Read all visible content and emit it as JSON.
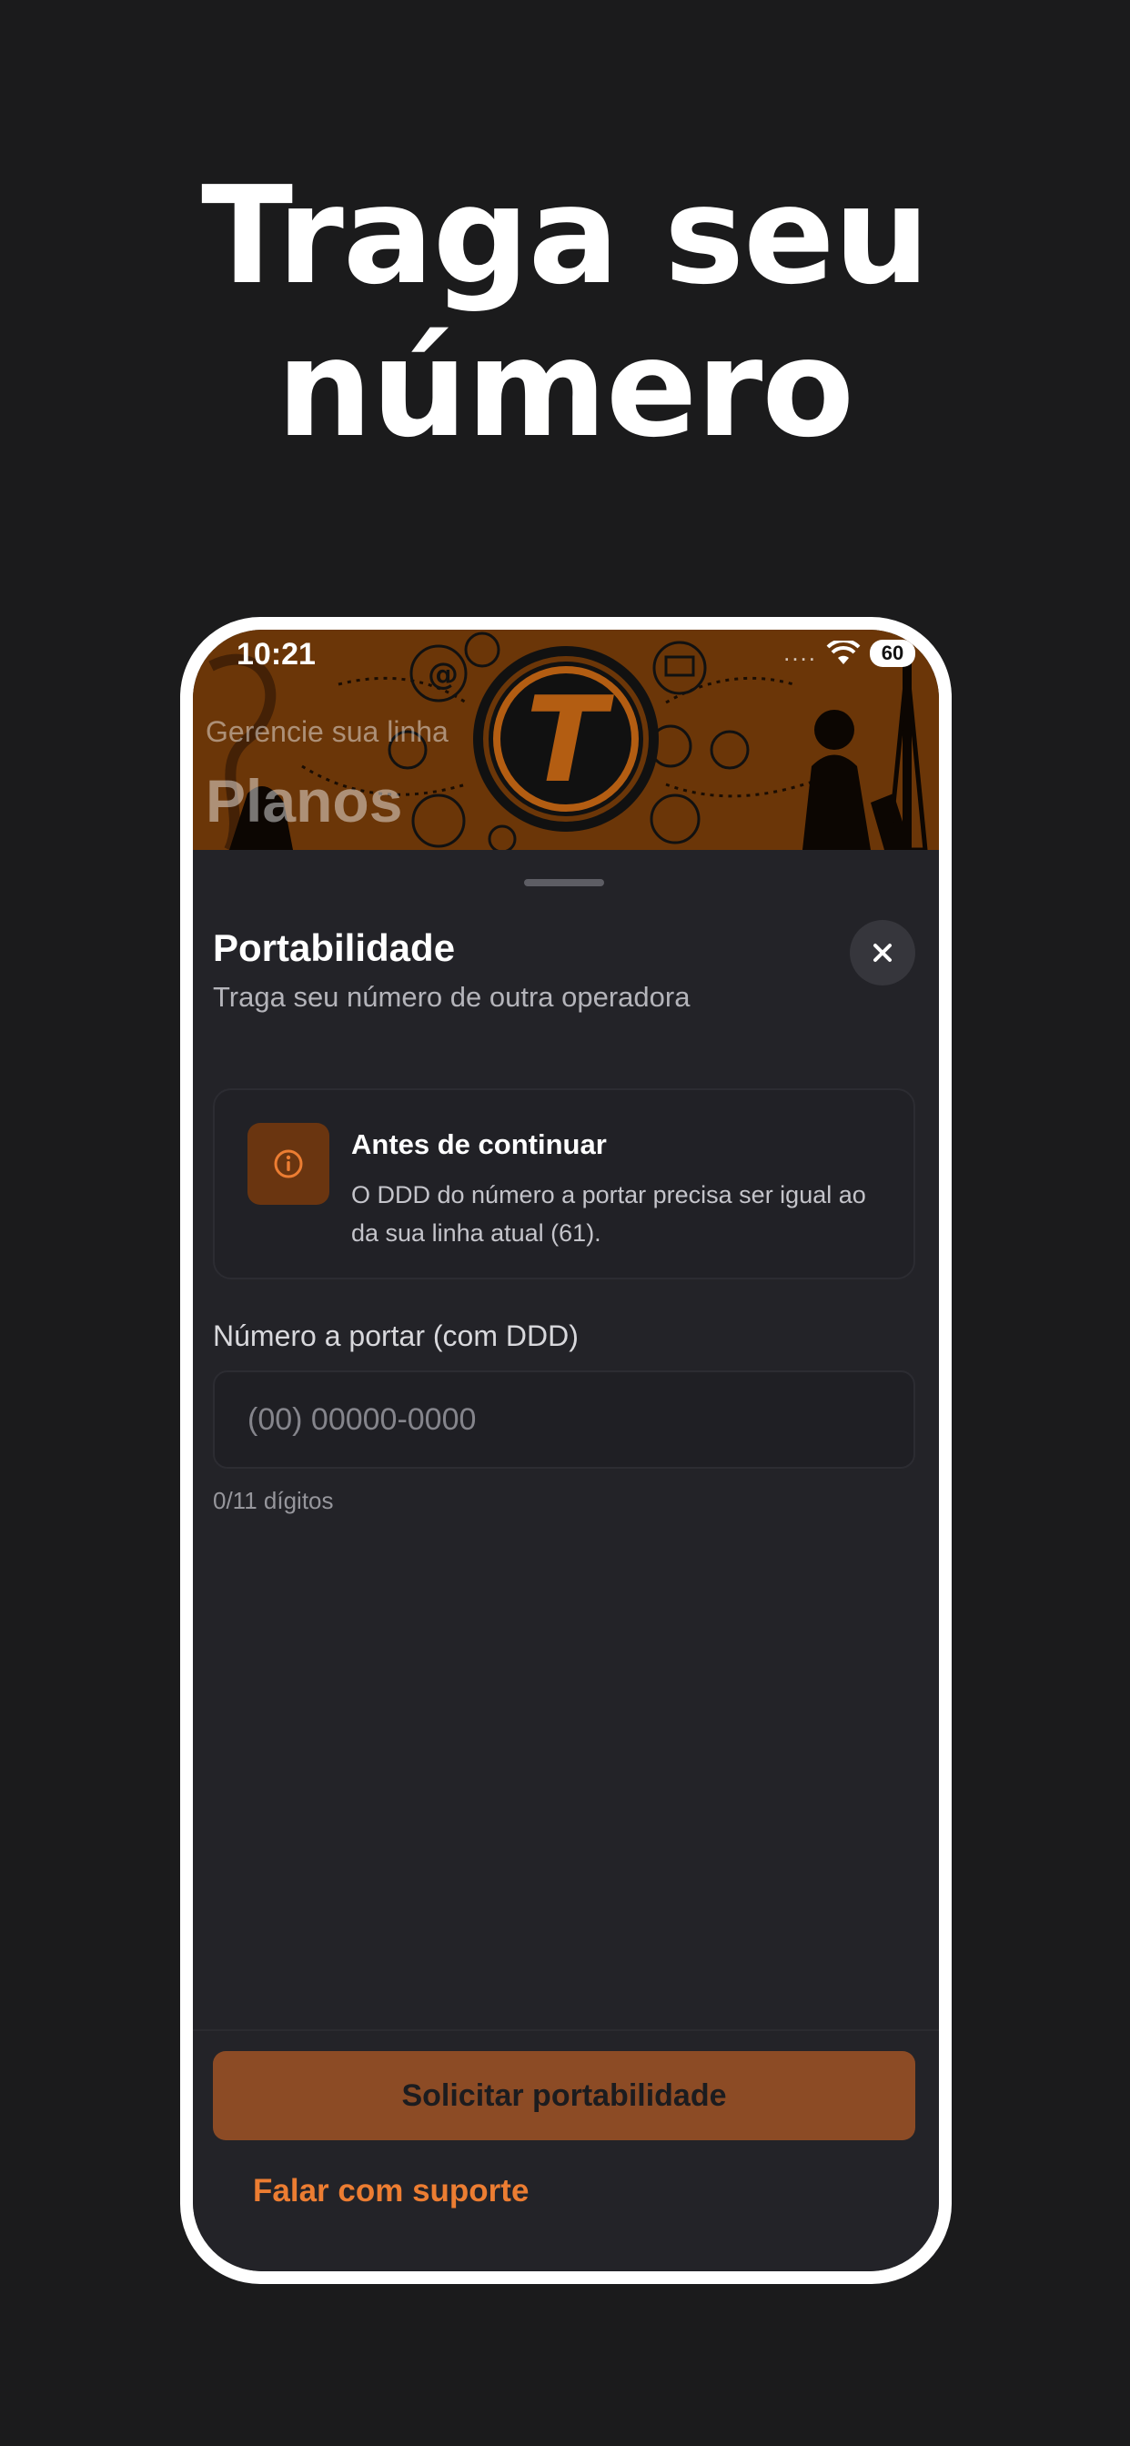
{
  "headline": {
    "line1": "Traga seu",
    "line2": "número"
  },
  "status_bar": {
    "time": "10:21",
    "signal": "....",
    "battery": "60"
  },
  "hero": {
    "subtitle": "Gerencie sua linha",
    "title": "Planos",
    "logo_letter": "T"
  },
  "sheet": {
    "title": "Portabilidade",
    "subtitle": "Traga seu número de outra operadora",
    "close_icon": "close-icon",
    "info_card": {
      "icon": "info-icon",
      "title": "Antes de continuar",
      "body": "O DDD do número a portar precisa ser igual ao da sua linha atual (61)."
    },
    "field": {
      "label": "Número a portar (com DDD)",
      "placeholder": "(00) 00000-0000",
      "value": "",
      "counter": "0/11 dígitos"
    },
    "primary_button": "Solicitar portabilidade",
    "support_link": "Falar com suporte"
  },
  "colors": {
    "background": "#1b1b1c",
    "sheet": "#232328",
    "accent": "#ec7d32",
    "button": "#8c4b25",
    "hero": "#6b3608"
  }
}
